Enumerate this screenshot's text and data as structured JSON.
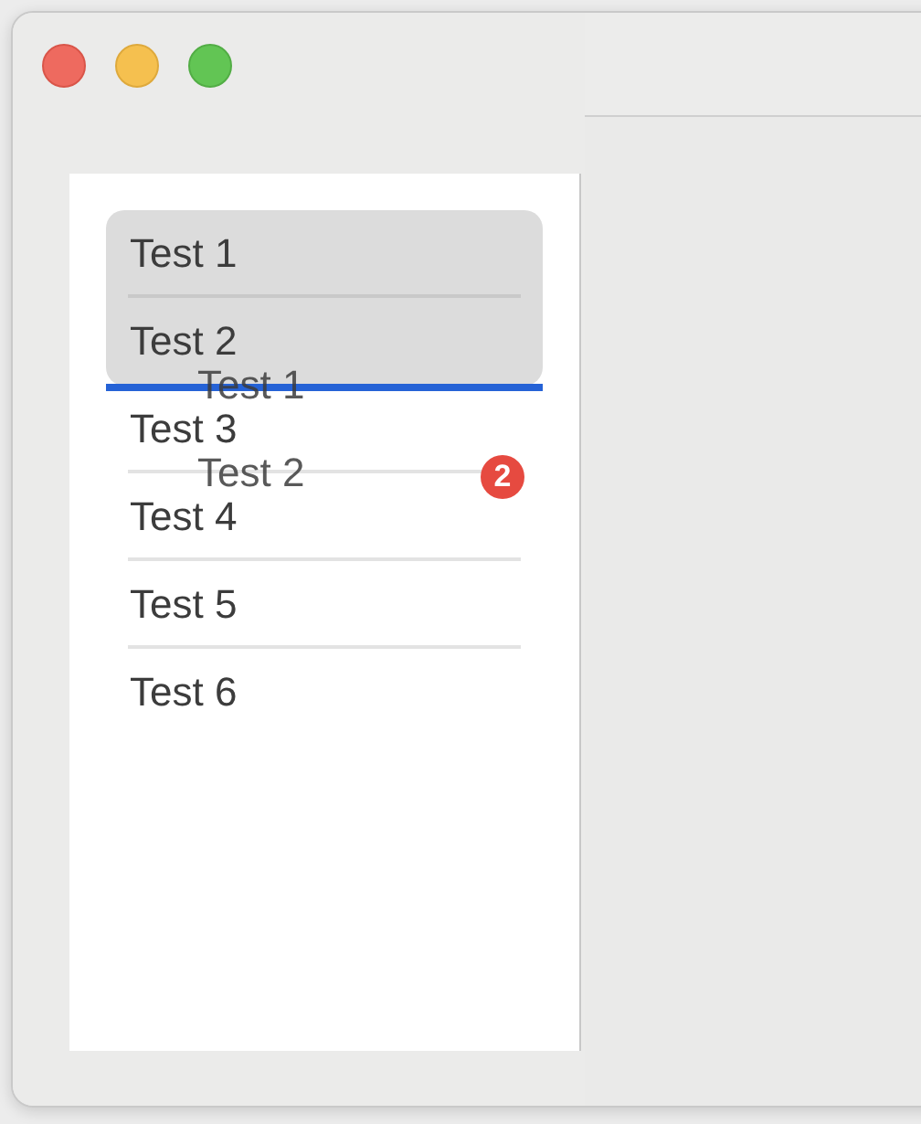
{
  "list": {
    "rows": [
      {
        "label": "Test 1",
        "selected": true,
        "drop_below": false
      },
      {
        "label": "Test 2",
        "selected": true,
        "drop_below": true
      },
      {
        "label": "Test 3",
        "selected": false,
        "drop_below": false
      },
      {
        "label": "Test 4",
        "selected": false,
        "drop_below": false
      },
      {
        "label": "Test 5",
        "selected": false,
        "drop_below": false
      },
      {
        "label": "Test 6",
        "selected": false,
        "drop_below": false
      }
    ]
  },
  "drag_preview": {
    "labels": [
      "Test 1",
      "Test 2"
    ],
    "badge": "2"
  }
}
